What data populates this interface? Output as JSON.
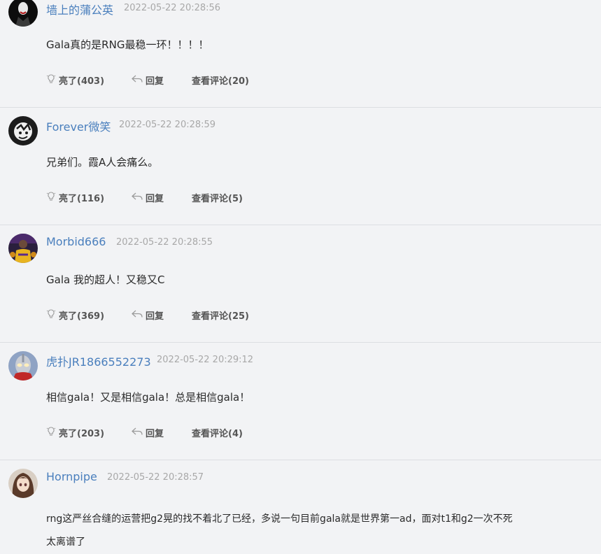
{
  "colors": {
    "background": "#f2f3f5",
    "username": "#4a7fbd",
    "timestamp": "#a8a8a8",
    "divider": "#dcdee2",
    "action_text": "#555555"
  },
  "comments": [
    {
      "username": "墙上的蒲公英",
      "time": "2022-05-22 20:28:56",
      "content": [
        "Gala真的是RNG最稳一环！！！！"
      ],
      "like": "亮了(403)",
      "reply": "回复",
      "view": "查看评论(20)",
      "avatar_icon": "joker-avatar-icon"
    },
    {
      "username": "Forever微笑",
      "time": "2022-05-22 20:28:59",
      "content": [
        "兄弟们。霞A人会痛么。"
      ],
      "like": "亮了(116)",
      "reply": "回复",
      "view": "查看评论(5)",
      "avatar_icon": "cartoon-avatar-icon"
    },
    {
      "username": "Morbid666",
      "time": "2022-05-22 20:28:55",
      "content": [
        "Gala 我的超人！又稳又C"
      ],
      "like": "亮了(369)",
      "reply": "回复",
      "view": "查看评论(25)",
      "avatar_icon": "player-avatar-icon"
    },
    {
      "username": "虎扑JR1866552273",
      "time": "2022-05-22 20:29:12",
      "content": [
        "相信gala！又是相信gala！总是相信gala！"
      ],
      "like": "亮了(203)",
      "reply": "回复",
      "view": "查看评论(4)",
      "avatar_icon": "ultraman-avatar-icon"
    },
    {
      "username": "Hornpipe",
      "time": "2022-05-22 20:28:57",
      "content": [
        "rng这严丝合缝的运营把g2晃的找不着北了已经，多说一句目前gala就是世界第一ad，面对t1和g2一次不死",
        "太离谱了"
      ],
      "avatar_icon": "anime-avatar-icon"
    }
  ]
}
